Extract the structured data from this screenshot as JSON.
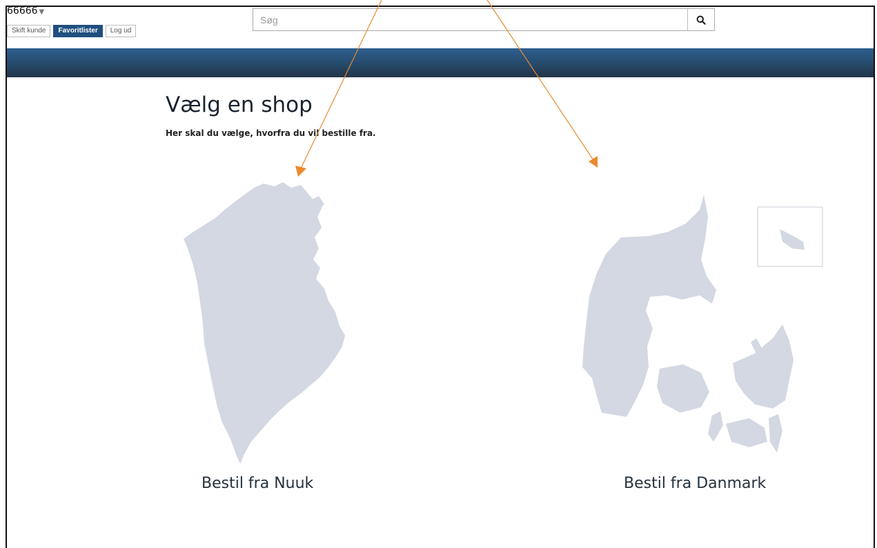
{
  "header": {
    "account_number": "66666",
    "buttons": {
      "switch_customer": "Skift kunde",
      "favorites": "Favoritlister",
      "logout": "Log ud"
    },
    "search": {
      "placeholder": "Søg",
      "value": ""
    }
  },
  "main": {
    "title": "Vælg en shop",
    "subtitle": "Her skal du vælge, hvorfra du vil bestille fra.",
    "shops": [
      {
        "label": "Bestil fra Nuuk",
        "map": "greenland-map-icon"
      },
      {
        "label": "Bestil fra Danmark",
        "map": "denmark-map-icon"
      }
    ]
  },
  "colors": {
    "navbar": "#264a6b",
    "primary_button": "#1f4f7f",
    "map_fill": "#d3d8e2",
    "annotation_arrow": "#e98a2f"
  }
}
